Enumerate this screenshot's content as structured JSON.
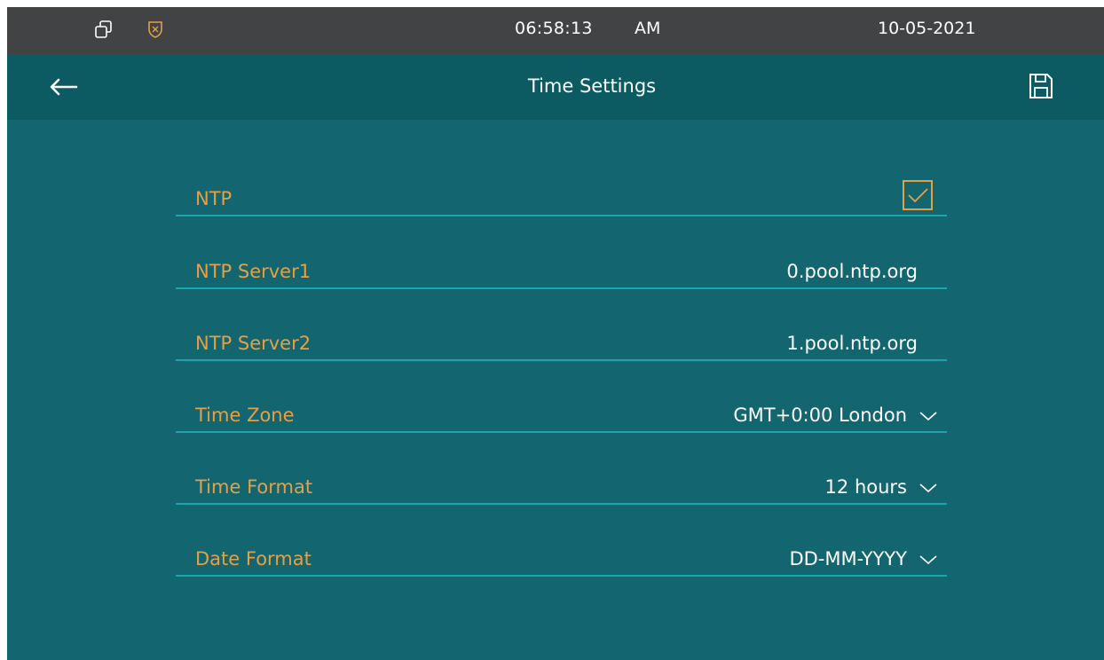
{
  "status_bar": {
    "time": "06:58:13",
    "ampm": "AM",
    "date": "10-05-2021",
    "icons": [
      "window-restore-icon",
      "shield-icon"
    ]
  },
  "header": {
    "title": "Time Settings",
    "back_icon": "arrow-left-icon",
    "save_icon": "floppy-disk-icon"
  },
  "settings": {
    "ntp": {
      "label": "NTP",
      "checked": true
    },
    "ntp_server1": {
      "label": "NTP Server1",
      "value": "0.pool.ntp.org"
    },
    "ntp_server2": {
      "label": "NTP Server2",
      "value": "1.pool.ntp.org"
    },
    "time_zone": {
      "label": "Time Zone",
      "value": "GMT+0:00 London"
    },
    "time_format": {
      "label": "Time Format",
      "value": "12 hours"
    },
    "date_format": {
      "label": "Date Format",
      "value": "DD-MM-YYYY"
    }
  },
  "colors": {
    "background": "#136670",
    "status_bar": "#414345",
    "title_bar": "#0d5b62",
    "label": "#e4a047",
    "divider": "#1aa6ae",
    "text": "#ffffff"
  }
}
